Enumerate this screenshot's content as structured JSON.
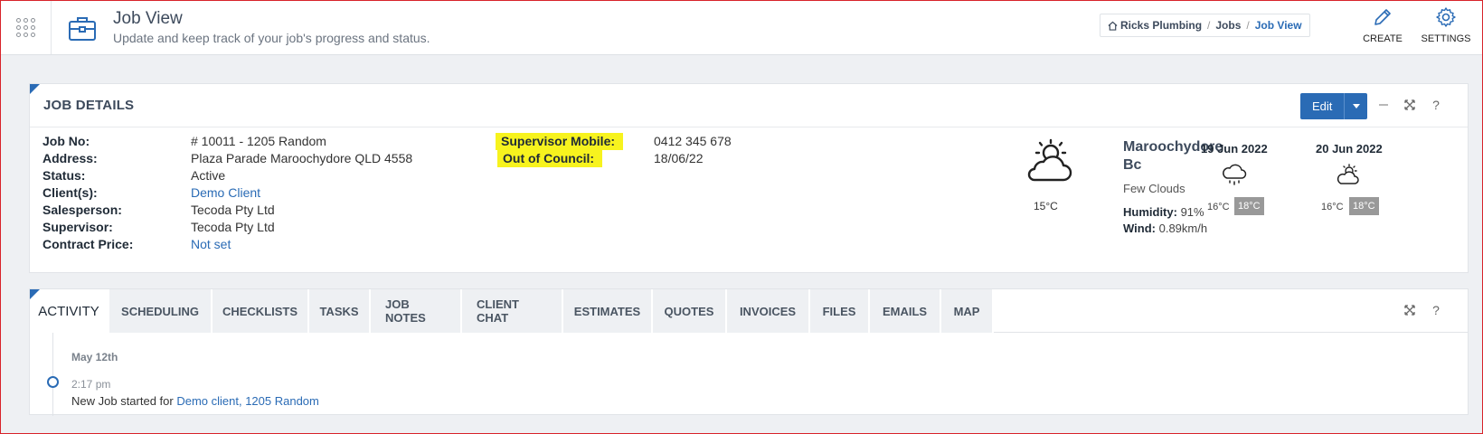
{
  "header": {
    "title": "Job View",
    "subtitle": "Update and keep track of your job's progress and status.",
    "breadcrumb": [
      "Ricks Plumbing",
      "Jobs",
      "Job View"
    ],
    "create_label": "CREATE",
    "settings_label": "SETTINGS"
  },
  "job_details": {
    "title": "JOB DETAILS",
    "edit_label": "Edit",
    "fields": {
      "job_no_label": "Job No:",
      "job_no": "# 10011 - 1205 Random",
      "address_label": "Address:",
      "address": "Plaza Parade Maroochydore QLD 4558",
      "status_label": "Status:",
      "status": "Active",
      "clients_label": "Client(s):",
      "clients": "Demo Client",
      "salesperson_label": "Salesperson:",
      "salesperson": "Tecoda Pty Ltd",
      "supervisor_label": "Supervisor:",
      "supervisor": "Tecoda Pty Ltd",
      "contract_label": "Contract Price:",
      "contract": "Not set",
      "sup_mobile_label": "Supervisor Mobile:",
      "sup_mobile": "0412 345 678",
      "council_label": "Out of Council:",
      "council": "18/06/22"
    },
    "highlight_color": "#f7f31e"
  },
  "weather": {
    "current_temp": "15°C",
    "location": "Maroochydore Bc",
    "condition": "Few Clouds",
    "humidity_label": "Humidity:",
    "humidity": "91%",
    "wind_label": "Wind:",
    "wind": "0.89km/h",
    "forecast": [
      {
        "date": "19 Jun 2022",
        "icon": "rain-cloud-icon",
        "low": "16°C",
        "high": "18°C"
      },
      {
        "date": "20 Jun 2022",
        "icon": "partly-cloudy-icon",
        "low": "16°C",
        "high": "18°C"
      }
    ]
  },
  "activity": {
    "tabs": [
      "ACTIVITY",
      "SCHEDULING",
      "CHECKLISTS",
      "TASKS",
      "JOB NOTES",
      "CLIENT CHAT",
      "ESTIMATES",
      "QUOTES",
      "INVOICES",
      "FILES",
      "EMAILS",
      "MAP"
    ],
    "active_tab": "ACTIVITY",
    "entries": [
      {
        "date": "May 12th",
        "time": "2:17 pm",
        "text": "New Job started for ",
        "link": "Demo client, 1205 Random"
      }
    ]
  },
  "colors": {
    "accent": "#2a6bb5",
    "border": "#d8232a"
  }
}
